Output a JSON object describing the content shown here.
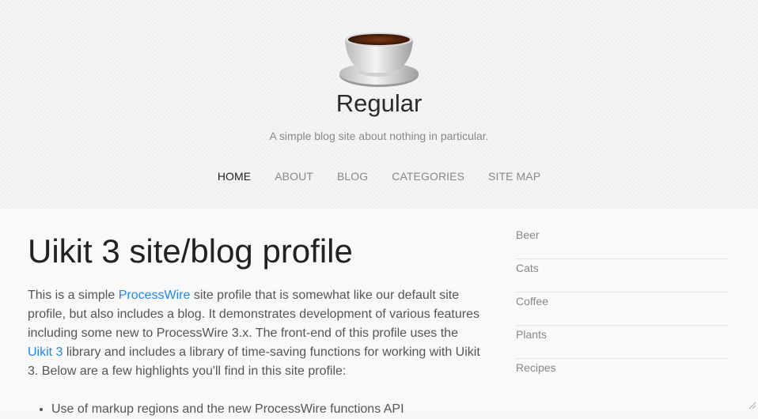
{
  "site": {
    "title": "Regular",
    "tagline": "A simple blog site about nothing in particular."
  },
  "nav": {
    "items": [
      {
        "label": "HOME",
        "active": true
      },
      {
        "label": "ABOUT",
        "active": false
      },
      {
        "label": "BLOG",
        "active": false
      },
      {
        "label": "CATEGORIES",
        "active": false
      },
      {
        "label": "SITE MAP",
        "active": false
      }
    ]
  },
  "main": {
    "title": "Uikit 3 site/blog profile",
    "intro": {
      "t1": "This is a simple ",
      "link1": "ProcessWire",
      "t2": " site profile that is somewhat like our default site profile, but also includes a blog. It demonstrates development of various features including some new to ProcessWire 3.x. The front-end of this profile uses the ",
      "link2": "Uikit 3",
      "t3": " library and includes a library of time-saving functions for working with Uikit 3. Below are a few highlights you'll find in this site profile:"
    },
    "bullets": [
      "Use of markup regions and the new ProcessWire functions API"
    ]
  },
  "sidebar": {
    "items": [
      "Beer",
      "Cats",
      "Coffee",
      "Plants",
      "Recipes"
    ]
  },
  "colors": {
    "link": "#1e87f0",
    "text": "#555555",
    "muted": "#888888",
    "nav_active": "#222222",
    "coffee": "#5a2a10"
  }
}
